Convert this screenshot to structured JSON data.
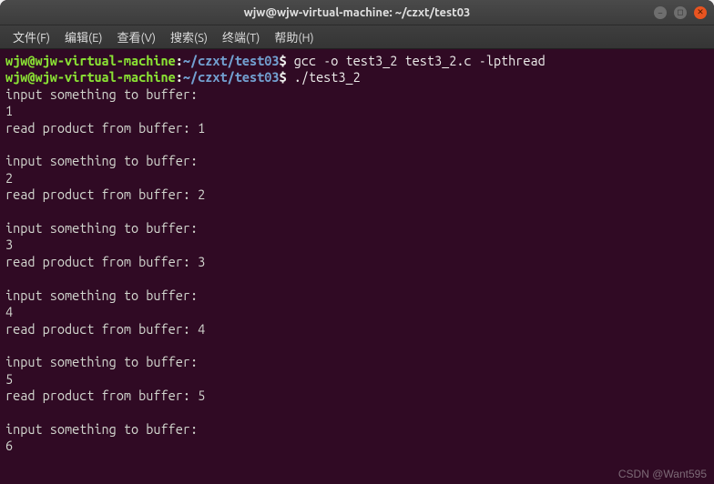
{
  "titlebar": {
    "title": "wjw@wjw-virtual-machine: ~/czxt/test03"
  },
  "menubar": {
    "items": [
      "文件(F)",
      "编辑(E)",
      "查看(V)",
      "搜索(S)",
      "终端(T)",
      "帮助(H)"
    ]
  },
  "prompt": {
    "user_host": "wjw@wjw-virtual-machine",
    "colon": ":",
    "path": "~/czxt/test03",
    "dollar": "$ "
  },
  "commands": {
    "cmd1": "gcc -o test3_2 test3_2.c -lpthread",
    "cmd2": "./test3_2"
  },
  "output": {
    "groups": [
      {
        "prompt": "input something to buffer:",
        "input": "1",
        "read": "read product from buffer: 1"
      },
      {
        "prompt": "input something to buffer:",
        "input": "2",
        "read": "read product from buffer: 2"
      },
      {
        "prompt": "input something to buffer:",
        "input": "3",
        "read": "read product from buffer: 3"
      },
      {
        "prompt": "input something to buffer:",
        "input": "4",
        "read": "read product from buffer: 4"
      },
      {
        "prompt": "input something to buffer:",
        "input": "5",
        "read": "read product from buffer: 5"
      }
    ],
    "tail_prompt": "input something to buffer:",
    "tail_input": "6"
  },
  "watermark": "CSDN @Want595"
}
